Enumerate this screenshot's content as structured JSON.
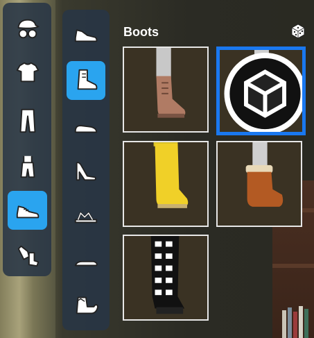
{
  "section_title": "Boots",
  "categories": [
    {
      "name": "hats-glasses",
      "active": false
    },
    {
      "name": "tshirt",
      "active": false
    },
    {
      "name": "pants",
      "active": false
    },
    {
      "name": "dress",
      "active": false
    },
    {
      "name": "shoes",
      "active": true
    },
    {
      "name": "gloves-socks",
      "active": false
    }
  ],
  "subcategories": [
    {
      "name": "sneaker",
      "active": false
    },
    {
      "name": "boot",
      "active": true
    },
    {
      "name": "loafer",
      "active": false
    },
    {
      "name": "high-heel",
      "active": false
    },
    {
      "name": "sandal",
      "active": false
    },
    {
      "name": "slipper",
      "active": false
    },
    {
      "name": "elf-shoe",
      "active": false
    }
  ],
  "items": [
    {
      "name": "brown-lace-up-boot",
      "selected": false,
      "color": "#a0705a"
    },
    {
      "name": "black-combat-boot",
      "selected": true,
      "color": "#1c1c1c",
      "badge": "owned-cube-icon"
    },
    {
      "name": "yellow-rain-boot",
      "selected": false,
      "color": "#e8c62a"
    },
    {
      "name": "brown-ugg-boot",
      "selected": false,
      "color": "#b35a23"
    },
    {
      "name": "black-white-buckle-boot",
      "selected": false,
      "color": "#111111"
    }
  ],
  "accent_color": "#2aa4ef",
  "selection_color": "#1a78f0"
}
